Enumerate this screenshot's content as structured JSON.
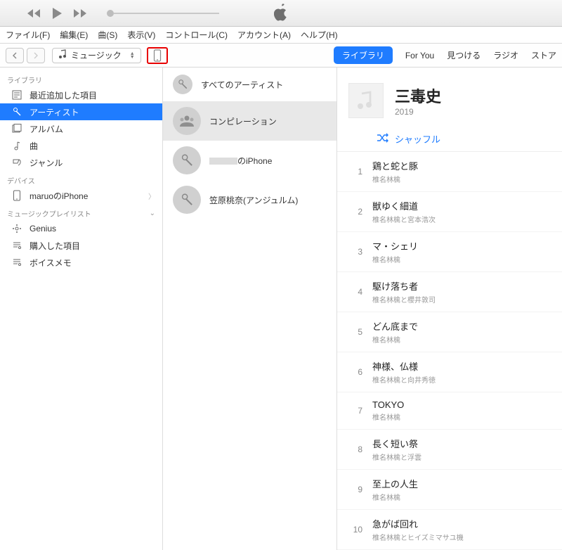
{
  "menu": {
    "file": "ファイル(F)",
    "edit": "編集(E)",
    "song": "曲(S)",
    "view": "表示(V)",
    "control": "コントロール(C)",
    "account": "アカウント(A)",
    "help": "ヘルプ(H)"
  },
  "toolbar": {
    "media_label": "ミュージック"
  },
  "tabs": {
    "library": "ライブラリ",
    "for_you": "For You",
    "discover": "見つける",
    "radio": "ラジオ",
    "store": "ストア"
  },
  "sidebar": {
    "library_head": "ライブラリ",
    "library": [
      {
        "label": "最近追加した項目"
      },
      {
        "label": "アーティスト"
      },
      {
        "label": "アルバム"
      },
      {
        "label": "曲"
      },
      {
        "label": "ジャンル"
      }
    ],
    "device_head": "デバイス",
    "devices": [
      {
        "label": "maruoのiPhone"
      }
    ],
    "playlist_head": "ミュージックプレイリスト",
    "playlists": [
      {
        "label": "Genius"
      },
      {
        "label": "購入した項目"
      },
      {
        "label": "ボイスメモ"
      }
    ]
  },
  "artists": [
    {
      "label": "すべてのアーティスト"
    },
    {
      "label": "コンピレーション"
    },
    {
      "label": "のiPhone",
      "redacted": true
    },
    {
      "label": "笠原桃奈(アンジュルム)"
    }
  ],
  "album": {
    "title": "三毒史",
    "year": "2019",
    "shuffle": "シャッフル"
  },
  "tracks": [
    {
      "n": "1",
      "title": "鶏と蛇と豚",
      "artist": "椎名林檎"
    },
    {
      "n": "2",
      "title": "獣ゆく細道",
      "artist": "椎名林檎と宮本浩次"
    },
    {
      "n": "3",
      "title": "マ・シェリ",
      "artist": "椎名林檎"
    },
    {
      "n": "4",
      "title": "駆け落ち者",
      "artist": "椎名林檎と櫻井敦司"
    },
    {
      "n": "5",
      "title": "どん底まで",
      "artist": "椎名林檎"
    },
    {
      "n": "6",
      "title": "神様、仏様",
      "artist": "椎名林檎と向井秀徳"
    },
    {
      "n": "7",
      "title": "TOKYO",
      "artist": "椎名林檎"
    },
    {
      "n": "8",
      "title": "長く短い祭",
      "artist": "椎名林檎と浮雲"
    },
    {
      "n": "9",
      "title": "至上の人生",
      "artist": "椎名林檎"
    },
    {
      "n": "10",
      "title": "急がば回れ",
      "artist": "椎名林檎とヒイズミマサユ機"
    }
  ]
}
